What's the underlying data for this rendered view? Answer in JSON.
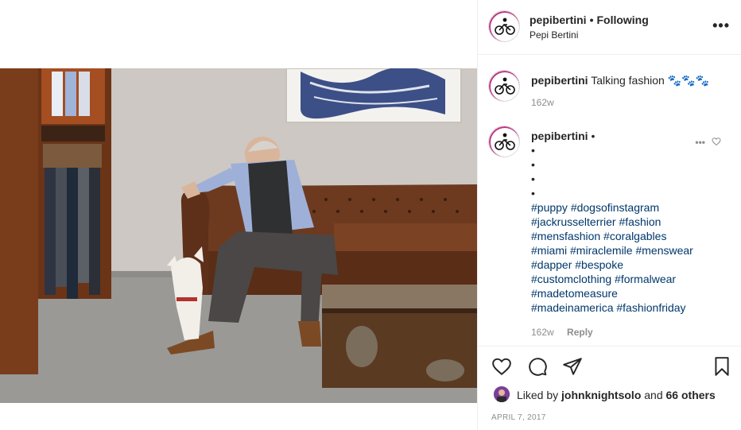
{
  "post": {
    "username": "pepibertini",
    "dot": "•",
    "follow_status": "Following",
    "display_name": "Pepi Bertini",
    "more": "•••"
  },
  "caption": {
    "username": "pepibertini",
    "text": "Talking fashion 🐾🐾🐾",
    "time": "162w"
  },
  "comment": {
    "username": "pepibertini",
    "dot": "•",
    "bullets": [
      "•",
      "•",
      "•",
      "•"
    ],
    "hashtag_lines": [
      "#puppy #dogsofinstagram",
      "#jackrusselterrier #fashion",
      "#mensfashion #coralgables",
      "#miami #miraclemile #menswear",
      "#dapper #bespoke",
      "#customclothing #formalwear",
      "#madetomeasure",
      "#madeinamerica #fashionfriday"
    ],
    "time": "162w",
    "reply": "Reply",
    "more": "•••"
  },
  "likes": {
    "prefix": "Liked by",
    "user": "johnknightsolo",
    "and": "and",
    "count": "66 others"
  },
  "date": "APRIL 7, 2017",
  "icons": [
    "heart-icon",
    "comment-icon",
    "share-icon",
    "bookmark-icon"
  ],
  "colors": {
    "link": "#00376b",
    "muted": "#8e8e8e",
    "text": "#262626",
    "border": "#efefef"
  }
}
